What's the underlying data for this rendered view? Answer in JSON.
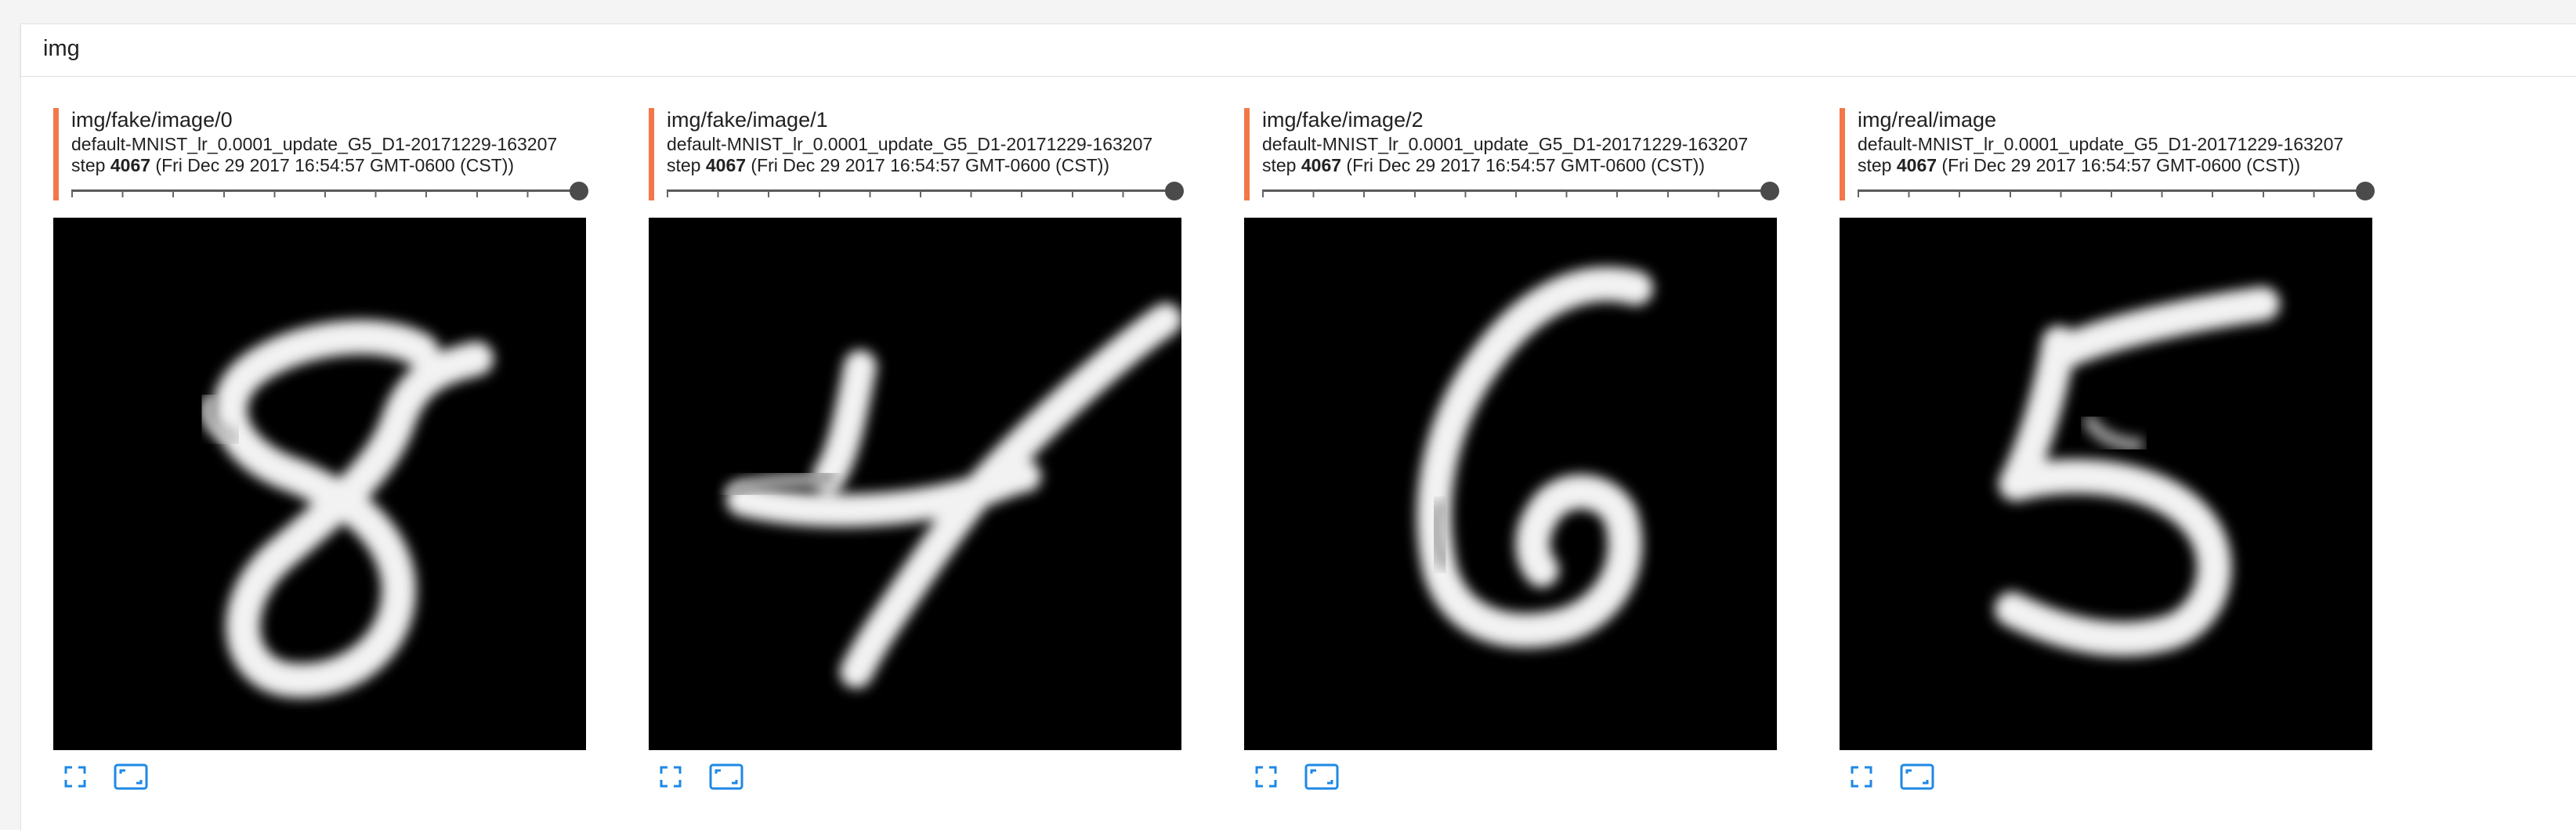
{
  "section": {
    "title": "img"
  },
  "cards": [
    {
      "tag": "img/fake/image/0",
      "run": "default-MNIST_lr_0.0001_update_G5_D1-20171229-163207",
      "step_prefix": "step ",
      "step": "4067",
      "time": " (Fri Dec 29 2017 16:54:57 GMT-0600 (CST))",
      "digit": "8"
    },
    {
      "tag": "img/fake/image/1",
      "run": "default-MNIST_lr_0.0001_update_G5_D1-20171229-163207",
      "step_prefix": "step ",
      "step": "4067",
      "time": " (Fri Dec 29 2017 16:54:57 GMT-0600 (CST))",
      "digit": "4"
    },
    {
      "tag": "img/fake/image/2",
      "run": "default-MNIST_lr_0.0001_update_G5_D1-20171229-163207",
      "step_prefix": "step ",
      "step": "4067",
      "time": " (Fri Dec 29 2017 16:54:57 GMT-0600 (CST))",
      "digit": "6"
    },
    {
      "tag": "img/real/image",
      "run": "default-MNIST_lr_0.0001_update_G5_D1-20171229-163207",
      "step_prefix": "step ",
      "step": "4067",
      "time": " (Fri Dec 29 2017 16:54:57 GMT-0600 (CST))",
      "digit": "5"
    }
  ],
  "icons": {
    "fullscreen": "fullscreen-icon",
    "actual_size": "actual-size-icon"
  },
  "colors": {
    "accent_bar": "#f4774a",
    "icon_blue": "#1e88e5"
  }
}
